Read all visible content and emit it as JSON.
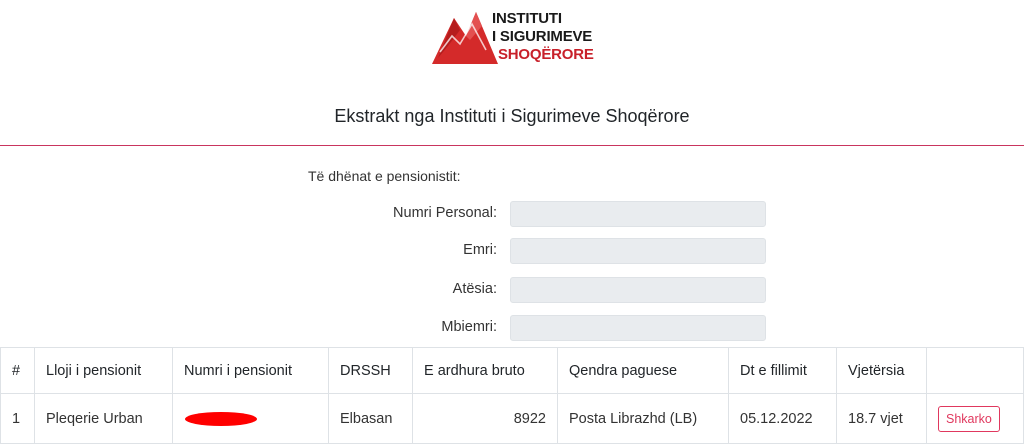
{
  "logo": {
    "line1": "INSTITUTI",
    "line2": "I SIGURIMEVE",
    "line3": "SHOQËRORE"
  },
  "page": {
    "title": "Ekstrakt nga Instituti i Sigurimeve Shoqërore"
  },
  "pensioner": {
    "section_label": "Të dhënat e pensionistit:",
    "fields": [
      {
        "label": "Numri Personal:",
        "value": ""
      },
      {
        "label": "Emri:",
        "value": ""
      },
      {
        "label": "Atësia:",
        "value": ""
      },
      {
        "label": "Mbiemri:",
        "value": ""
      }
    ]
  },
  "table": {
    "headers": [
      "#",
      "Lloji i pensionit",
      "Numri i pensionit",
      "DRSSH",
      "E ardhura bruto",
      "Qendra paguese",
      "Dt e fillimit",
      "Vjetërsia",
      ""
    ],
    "rows": [
      {
        "index": "1",
        "type": "Pleqerie Urban",
        "number": "",
        "drssh": "Elbasan",
        "gross_income": "8922",
        "payment_center": "Posta Librazhd (LB)",
        "start_date": "05.12.2022",
        "seniority": "18.7 vjet",
        "action": "Shkarko"
      }
    ]
  },
  "colors": {
    "accent": "#e0385e",
    "divider": "#c9355e",
    "logo_red": "#c8202a",
    "redaction": "#ff0000"
  }
}
